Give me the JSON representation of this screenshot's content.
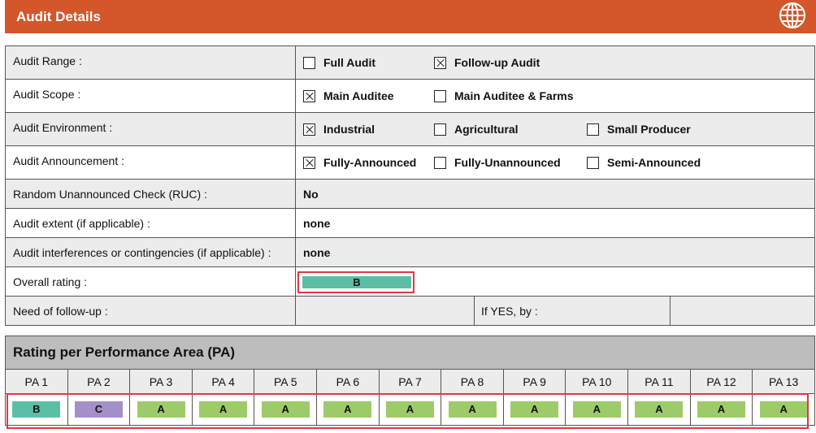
{
  "header": {
    "title": "Audit Details",
    "icon": "globe-icon"
  },
  "details": {
    "audit_range": {
      "label": "Audit Range :",
      "options": [
        {
          "label": "Full Audit",
          "checked": false
        },
        {
          "label": "Follow-up Audit",
          "checked": true
        }
      ]
    },
    "audit_scope": {
      "label": "Audit Scope :",
      "options": [
        {
          "label": "Main Auditee",
          "checked": true
        },
        {
          "label": "Main Auditee & Farms",
          "checked": false
        }
      ]
    },
    "audit_environment": {
      "label": "Audit Environment :",
      "options": [
        {
          "label": "Industrial",
          "checked": true
        },
        {
          "label": "Agricultural",
          "checked": false
        },
        {
          "label": "Small Producer",
          "checked": false
        }
      ]
    },
    "audit_announcement": {
      "label": "Audit Announcement :",
      "options": [
        {
          "label": "Fully-Announced",
          "checked": true
        },
        {
          "label": "Fully-Unannounced",
          "checked": false
        },
        {
          "label": "Semi-Announced",
          "checked": false
        }
      ]
    },
    "ruc": {
      "label": "Random Unannounced Check (RUC) :",
      "value": "No"
    },
    "extent": {
      "label": "Audit extent (if applicable) :",
      "value": "none"
    },
    "interferences": {
      "label": "Audit interferences or contingencies (if applicable) :",
      "value": "none"
    },
    "overall_rating": {
      "label": "Overall rating :",
      "value": "B",
      "color": "#5bbfa7"
    },
    "follow_up": {
      "label": "Need of follow-up :",
      "value": "",
      "if_yes_label": "If YES, by :",
      "if_yes_value": ""
    }
  },
  "pa": {
    "title": "Rating per Performance Area (PA)",
    "areas": [
      {
        "name": "PA 1",
        "rating": "B",
        "color": "#5bbfa7"
      },
      {
        "name": "PA 2",
        "rating": "C",
        "color": "#a48fc9"
      },
      {
        "name": "PA 3",
        "rating": "A",
        "color": "#9ecb6a"
      },
      {
        "name": "PA 4",
        "rating": "A",
        "color": "#9ecb6a"
      },
      {
        "name": "PA 5",
        "rating": "A",
        "color": "#9ecb6a"
      },
      {
        "name": "PA 6",
        "rating": "A",
        "color": "#9ecb6a"
      },
      {
        "name": "PA 7",
        "rating": "A",
        "color": "#9ecb6a"
      },
      {
        "name": "PA 8",
        "rating": "A",
        "color": "#9ecb6a"
      },
      {
        "name": "PA 9",
        "rating": "A",
        "color": "#9ecb6a"
      },
      {
        "name": "PA 10",
        "rating": "A",
        "color": "#9ecb6a"
      },
      {
        "name": "PA 11",
        "rating": "A",
        "color": "#9ecb6a"
      },
      {
        "name": "PA 12",
        "rating": "A",
        "color": "#9ecb6a"
      },
      {
        "name": "PA 13",
        "rating": "A",
        "color": "#9ecb6a"
      }
    ]
  },
  "colors": {
    "header": "#d4562b",
    "highlight": "#e0393e",
    "row_grey": "#ececec",
    "pa_title_bg": "#bdbdbd"
  }
}
